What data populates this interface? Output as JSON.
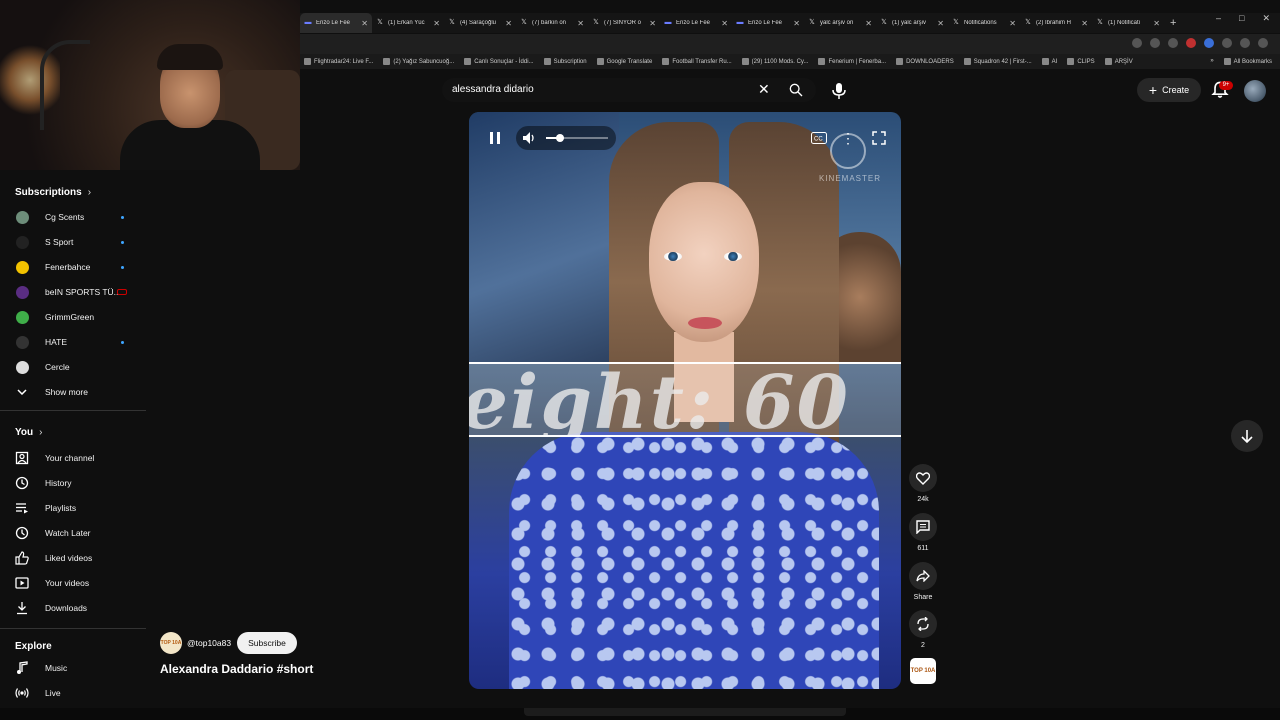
{
  "browser": {
    "tabs": [
      {
        "title": "Enzo Le Fée",
        "icon": "app-icon"
      },
      {
        "title": "(1) Erkan Yüc",
        "icon": "x-icon"
      },
      {
        "title": "(4) Saraçoğlu",
        "icon": "x-icon"
      },
      {
        "title": "(7) barkın on",
        "icon": "x-icon"
      },
      {
        "title": "(7) SİNYOR o",
        "icon": "x-icon"
      },
      {
        "title": "Enzo Le Fée",
        "icon": "app-icon"
      },
      {
        "title": "Enzo Le Fée",
        "icon": "app-icon"
      },
      {
        "title": "yalc arşiv on",
        "icon": "x-icon"
      },
      {
        "title": "(1) yalc arşiv",
        "icon": "x-icon"
      },
      {
        "title": "Notifications",
        "icon": "x-icon"
      },
      {
        "title": "(2) İbrahim H",
        "icon": "x-icon"
      },
      {
        "title": "(1) Notificati",
        "icon": "x-icon"
      }
    ],
    "bookmarks": [
      "Flightradar24: Live F...",
      "(2) Yağız Sabuncuoğ...",
      "Canlı Sonuçlar - İddi...",
      "Subscription",
      "Google Translate",
      "Football Transfer Ru...",
      "(29) 1100 Mods. Cy...",
      "Fenerium | Fenerba...",
      "DOWNLOADERS",
      "Squadron 42 | First-...",
      "AI",
      "CLIPS",
      "ARŞİV"
    ],
    "all_bookmarks": "All Bookmarks"
  },
  "header": {
    "search_query": "alessandra didario",
    "create_label": "Create",
    "notification_count": "9+"
  },
  "sidebar": {
    "subscriptions_title": "Subscriptions",
    "subscriptions": [
      {
        "label": "Cg Scents",
        "color": "#6d8d7a",
        "indicator": "dot"
      },
      {
        "label": "S Sport",
        "color": "#222222",
        "indicator": "dot"
      },
      {
        "label": "Fenerbahce",
        "color": "#f2c200",
        "indicator": "dot"
      },
      {
        "label": "beIN SPORTS TÜ...",
        "color": "#5a2d82",
        "indicator": "live"
      },
      {
        "label": "GrimmGreen",
        "color": "#3fae49",
        "indicator": "none"
      },
      {
        "label": "HATE",
        "color": "#333333",
        "indicator": "dot"
      },
      {
        "label": "Cercle",
        "color": "#dddddd",
        "indicator": "none"
      }
    ],
    "show_more": "Show more",
    "you_title": "You",
    "you_items": [
      {
        "label": "Your channel",
        "icon": "your-channel-icon"
      },
      {
        "label": "History",
        "icon": "history-icon"
      },
      {
        "label": "Playlists",
        "icon": "playlists-icon"
      },
      {
        "label": "Watch Later",
        "icon": "watch-later-icon"
      },
      {
        "label": "Liked videos",
        "icon": "liked-icon"
      },
      {
        "label": "Your videos",
        "icon": "your-videos-icon"
      },
      {
        "label": "Downloads",
        "icon": "downloads-icon"
      }
    ],
    "explore_title": "Explore",
    "explore_items": [
      {
        "label": "Music",
        "icon": "music-icon"
      },
      {
        "label": "Live",
        "icon": "live-icon"
      }
    ]
  },
  "short": {
    "overlay_text": "eight: 60",
    "watermark": "KINEMASTER",
    "volume_level": 0.22,
    "channel_handle": "@top10a83",
    "channel_avatar_text": "TOP 10A",
    "subscribe_label": "Subscribe",
    "title": "Alexandra Daddario #short",
    "likes": "24k",
    "comments": "611",
    "share_label": "Share",
    "remix_count": "2"
  },
  "colors": {
    "background": "#0f0f0f",
    "accent": "#3ea6ff",
    "badge": "#cc0000"
  }
}
